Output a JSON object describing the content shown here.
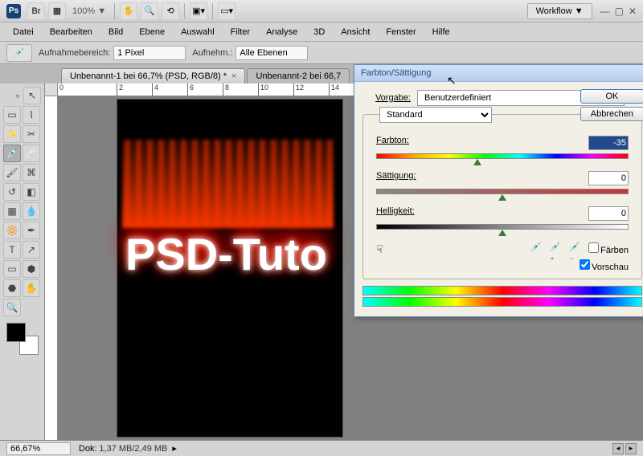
{
  "app": {
    "logo": "Ps",
    "workflow": "Workflow ▼",
    "zoom": "100% ▼"
  },
  "menu": [
    "Datei",
    "Bearbeiten",
    "Bild",
    "Ebene",
    "Auswahl",
    "Filter",
    "Analyse",
    "3D",
    "Ansicht",
    "Fenster",
    "Hilfe"
  ],
  "options": {
    "aufnahme_label": "Aufnahmebereich:",
    "aufnahme_value": "1 Pixel",
    "aufnehm_label": "Aufnehm.:",
    "aufnehm_value": "Alle Ebenen"
  },
  "tabs": [
    {
      "label": "Unbenannt-1 bei 66,7% (PSD, RGB/8) *",
      "active": true
    },
    {
      "label": "Unbenannt-2 bei 66,7",
      "active": false
    }
  ],
  "ruler_marks": [
    "0",
    "2",
    "4",
    "6",
    "8",
    "10",
    "12",
    "14"
  ],
  "canvas": {
    "text": "PSD-Tuto"
  },
  "dialog": {
    "title": "Farbton/Sättigung",
    "preset_label": "Vorgabe:",
    "preset_value": "Benutzerdefiniert",
    "channel": "Standard",
    "hue_label": "Farbton:",
    "hue_value": "-35",
    "sat_label": "Sättigung:",
    "sat_value": "0",
    "light_label": "Helligkeit:",
    "light_value": "0",
    "ok": "OK",
    "cancel": "Abbrechen",
    "colorize": "Färben",
    "preview": "Vorschau"
  },
  "status": {
    "zoom": "66,67%",
    "doc_label": "Dok:",
    "doc_value": "1,37 MB/2,49 MB"
  }
}
